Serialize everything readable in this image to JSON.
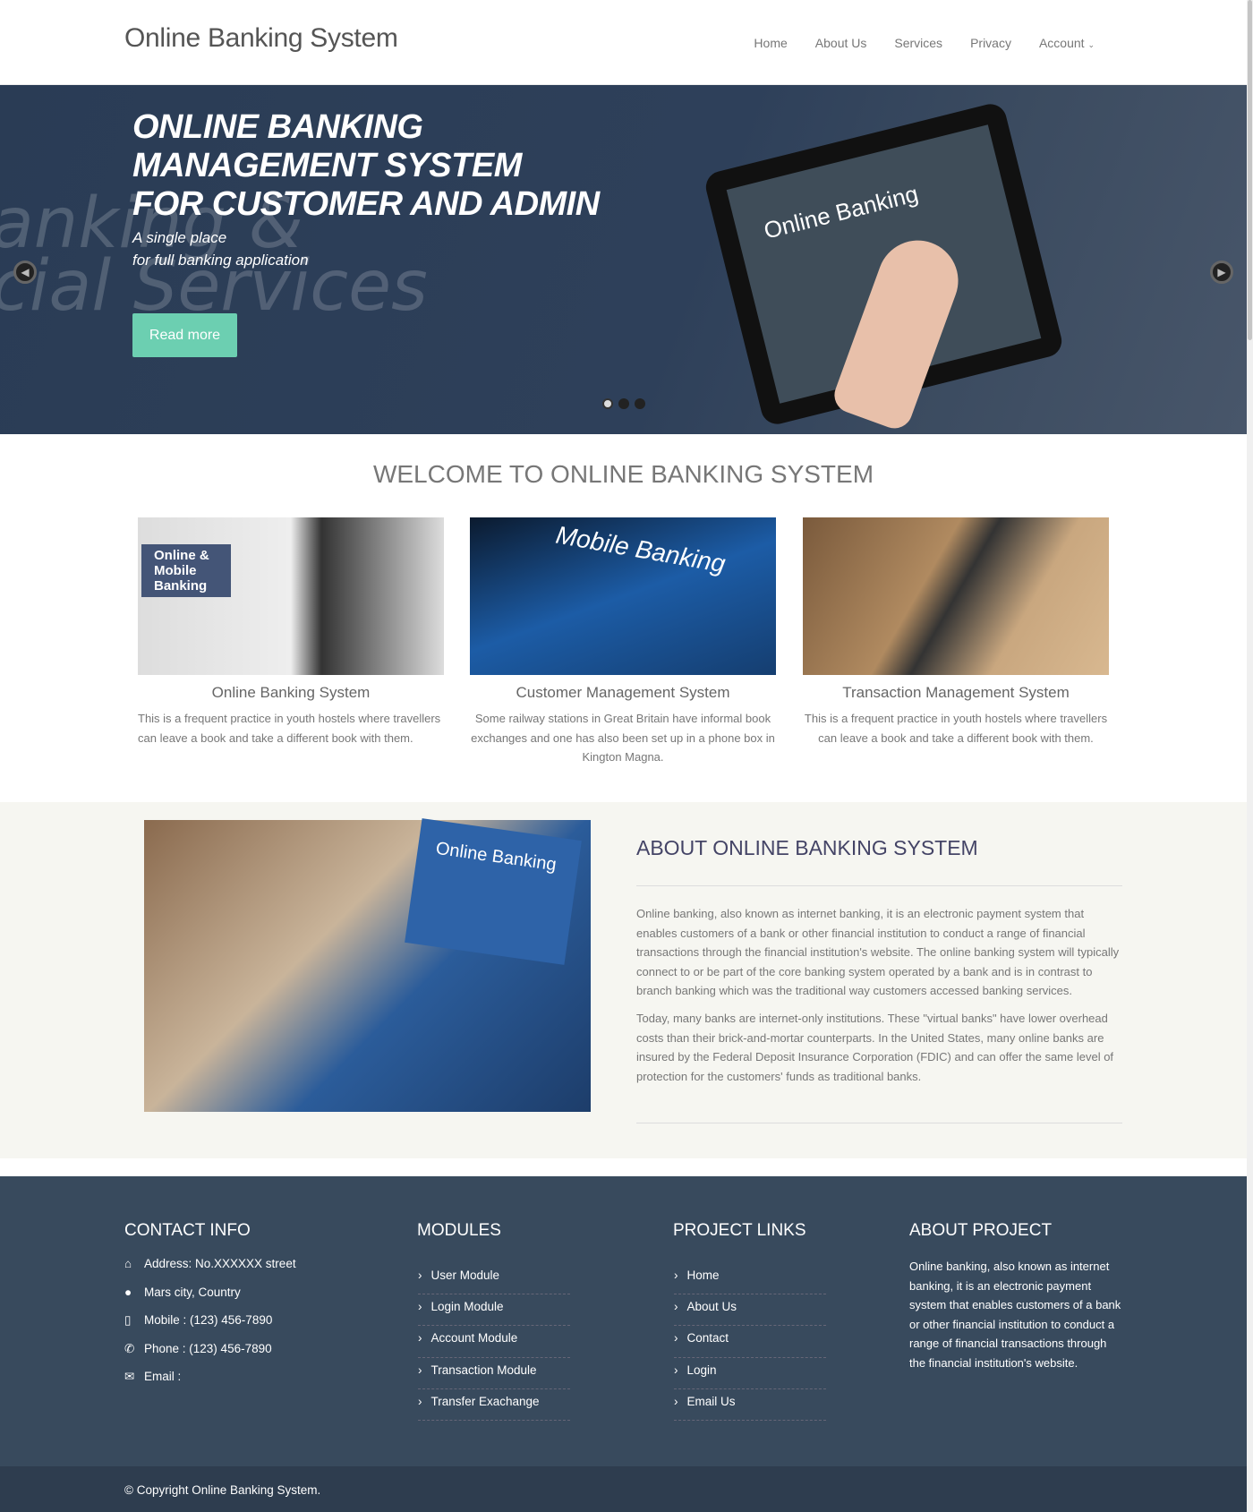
{
  "header": {
    "logo": "Online Banking System",
    "nav": [
      "Home",
      "About Us",
      "Services",
      "Privacy",
      "Account"
    ]
  },
  "hero": {
    "title_lines": [
      "ONLINE BANKING",
      "MANAGEMENT SYSTEM",
      "FOR CUSTOMER AND ADMIN"
    ],
    "sub_lines": [
      "A single place",
      "for full banking application"
    ],
    "button": "Read more",
    "bg_text_1": "anking &",
    "bg_text_2": "cial Services",
    "tablet_text": "Online Banking",
    "slides": 3,
    "active_slide": 1
  },
  "welcome": {
    "title": "WELCOME TO ONLINE BANKING SYSTEM",
    "cards": [
      {
        "title": "Online Banking System",
        "text": "This is a frequent practice in youth hostels where travellers can leave a book and take a different book with them.",
        "img_text": "Online & Mobile Banking"
      },
      {
        "title": "Customer Management System",
        "text": "Some railway stations in Great Britain have informal book exchanges and one has also been set up in a phone box in Kington Magna.",
        "img_text": "Mobile Banking"
      },
      {
        "title": "Transaction Management System",
        "text": "This is a frequent practice in youth hostels where travellers can leave a book and take a different book with them."
      }
    ]
  },
  "about": {
    "title": "ABOUT ONLINE BANKING SYSTEM",
    "img_text": "Online Banking",
    "paragraphs": [
      "Online banking, also known as internet banking, it is an electronic payment system that enables customers of a bank or other financial institution to conduct a range of financial transactions through the financial institution's website. The online banking system will typically connect to or be part of the core banking system operated by a bank and is in contrast to branch banking which was the traditional way customers accessed banking services.",
      "Today, many banks are internet-only institutions. These \"virtual banks\" have lower overhead costs than their brick-and-mortar counterparts. In the United States, many online banks are insured by the Federal Deposit Insurance Corporation (FDIC) and can offer the same level of protection for the customers' funds as traditional banks."
    ]
  },
  "footer": {
    "contact_title": "CONTACT INFO",
    "contact": [
      {
        "icon": "home-icon",
        "text": "Address: No.XXXXXX street"
      },
      {
        "icon": "globe-icon",
        "text": "Mars city, Country"
      },
      {
        "icon": "mobile-icon",
        "text": "Mobile : (123) 456-7890"
      },
      {
        "icon": "phone-icon",
        "text": "Phone : (123) 456-7890"
      },
      {
        "icon": "envelope-icon",
        "text": "Email :"
      }
    ],
    "modules_title": "MODULES",
    "modules": [
      "User Module",
      "Login Module",
      "Account Module",
      "Transaction Module",
      "Transfer Exachange"
    ],
    "links_title": "PROJECT LINKS",
    "links": [
      "Home",
      "About Us",
      "Contact",
      "Login",
      "Email Us"
    ],
    "about_title": "ABOUT PROJECT",
    "about_text": "Online banking, also known as internet banking, it is an electronic payment system that enables customers of a bank or other financial institution to conduct a range of financial transactions through the financial institution's website.",
    "copyright": "© Copyright Online Banking System."
  },
  "colors": {
    "accent": "#6ccfb1",
    "footer": "#384a5d",
    "footer_bottom": "#2e3d4f",
    "hero": "#2e405a"
  }
}
